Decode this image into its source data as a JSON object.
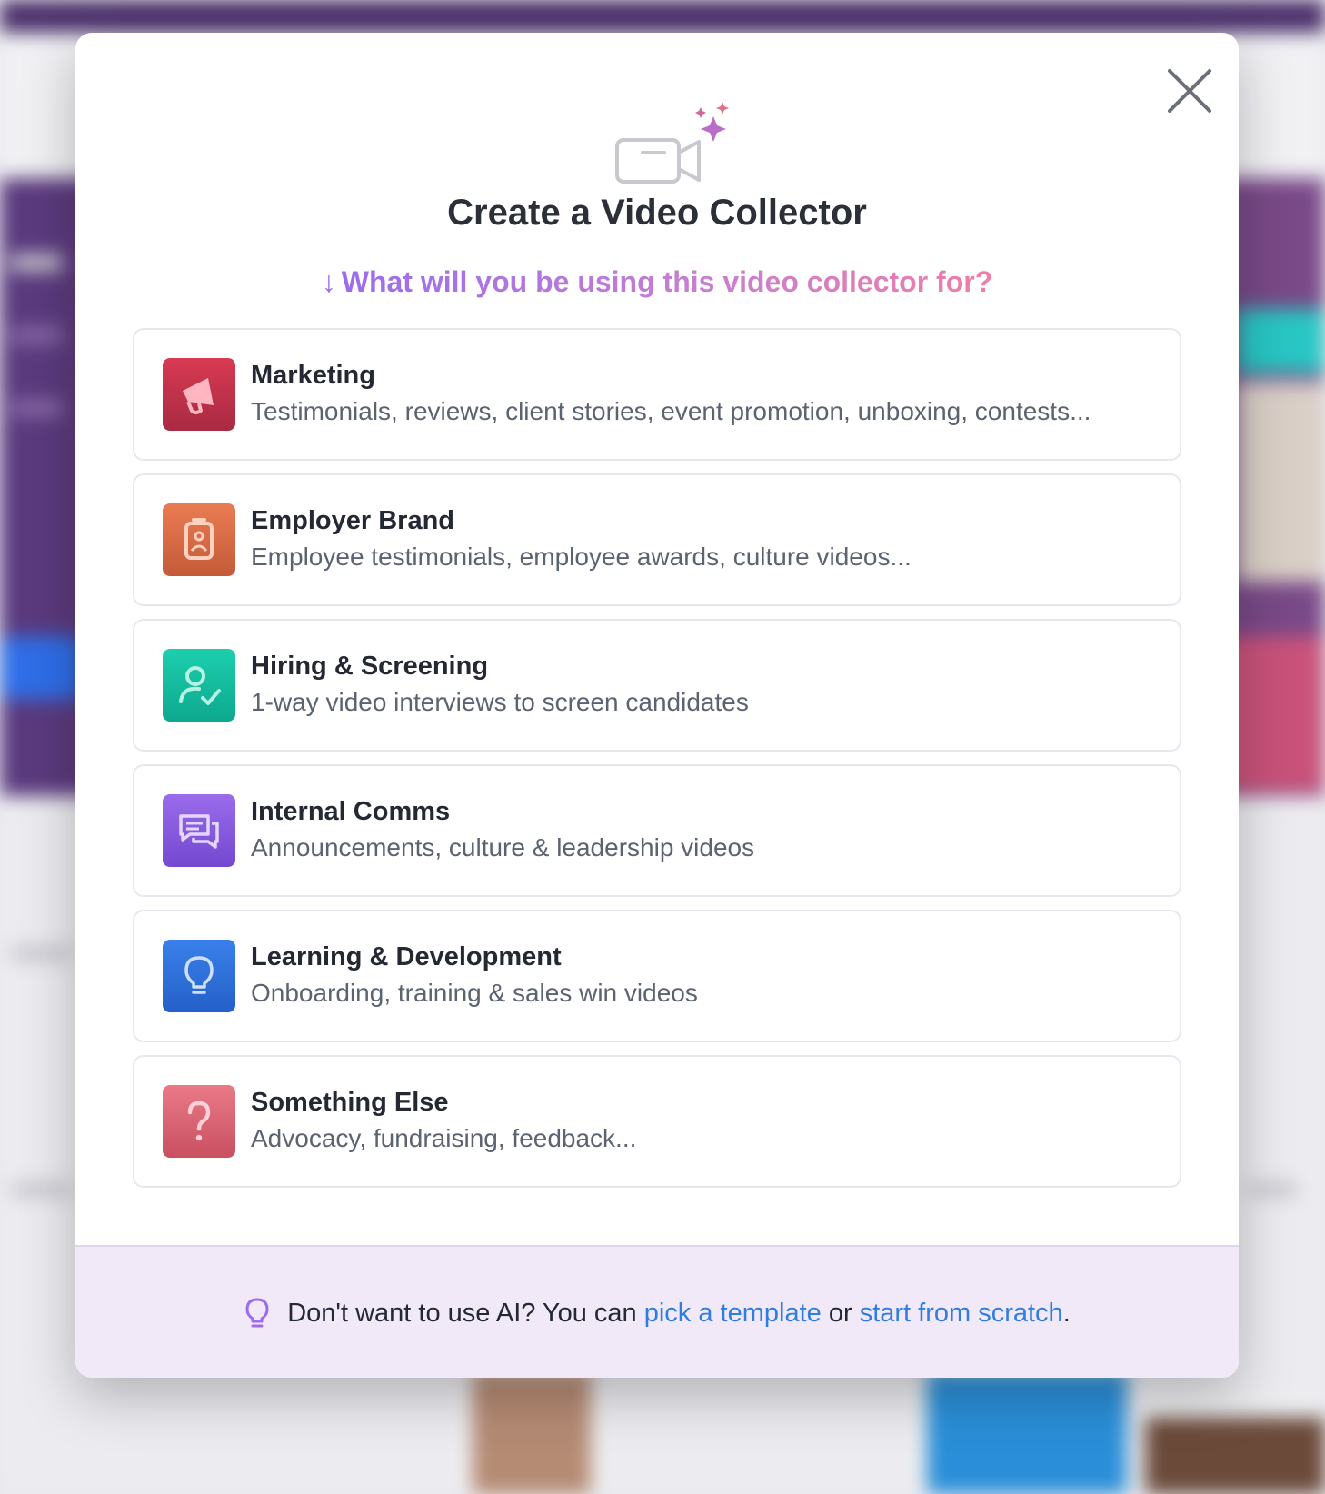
{
  "modal": {
    "title": "Create a Video Collector",
    "subtitle": {
      "arrow": "↓",
      "text": "What will you be using this video collector for?"
    },
    "options": [
      {
        "title": "Marketing",
        "description": "Testimonials, reviews, client stories, event promotion, unboxing, contests...",
        "icon": "megaphone-icon",
        "color": "#c8364f"
      },
      {
        "title": "Employer Brand",
        "description": "Employee testimonials, employee awards, culture videos...",
        "icon": "id-badge-icon",
        "color": "#e0704a"
      },
      {
        "title": "Hiring & Screening",
        "description": "1-way video interviews to screen candidates",
        "icon": "user-check-icon",
        "color": "#14bfa4"
      },
      {
        "title": "Internal Comms",
        "description": "Announcements, culture & leadership videos",
        "icon": "chat-bubbles-icon",
        "color": "#8b5ce0"
      },
      {
        "title": "Learning & Development",
        "description": "Onboarding, training & sales win videos",
        "icon": "lightbulb-icon",
        "color": "#2f72e0"
      },
      {
        "title": "Something Else",
        "description": "Advocacy, fundraising, feedback...",
        "icon": "question-mark-icon",
        "color": "#e06a7a"
      }
    ],
    "footer": {
      "prefix": "Don't want to use AI? You can ",
      "template_link": "pick a template",
      "middle": " or ",
      "scratch_link": "start from scratch",
      "suffix": "."
    }
  }
}
